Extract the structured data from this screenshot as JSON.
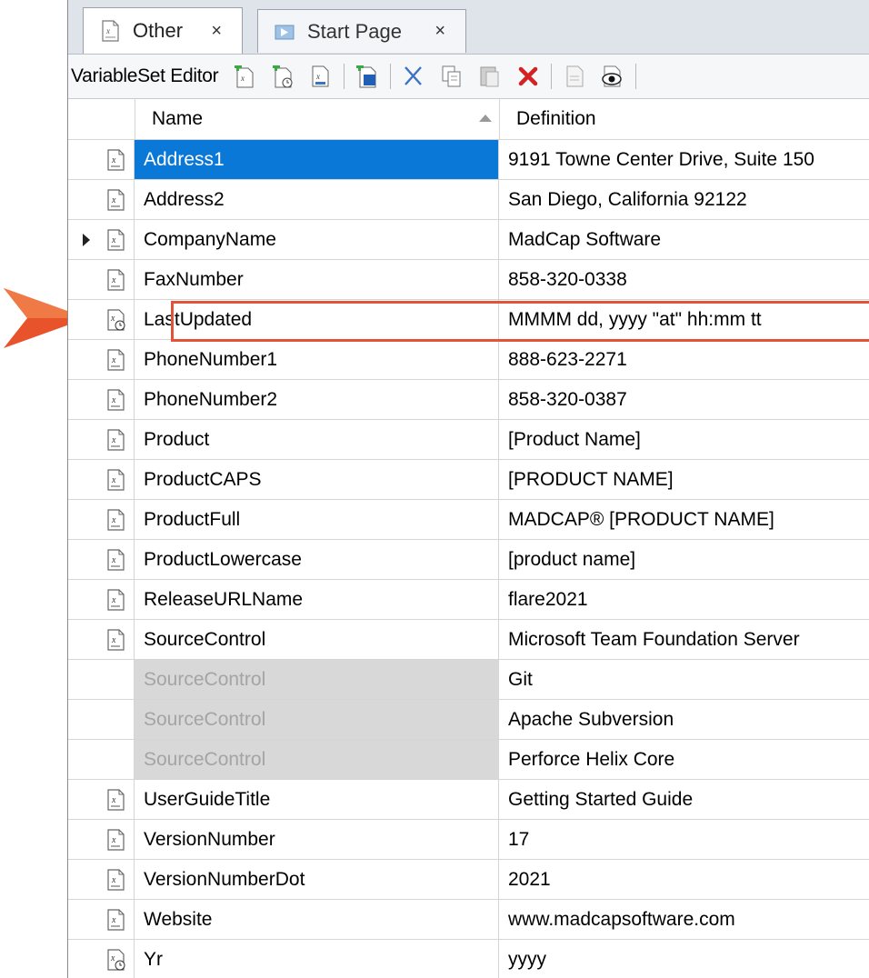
{
  "tabs": [
    {
      "label": "Other",
      "close": "×",
      "active": true,
      "icon": "variable-set-file-icon"
    },
    {
      "label": "Start Page",
      "close": "×",
      "active": false,
      "icon": "start-page-icon"
    }
  ],
  "toolbar": {
    "title": "VariableSet Editor",
    "buttons": [
      {
        "name": "add-text-variable-button",
        "icon": "add-variable-icon"
      },
      {
        "name": "add-datetime-variable-button",
        "icon": "add-datetime-variable-icon"
      },
      {
        "name": "edit-variable-button",
        "icon": "edit-variable-icon"
      },
      {
        "name": "add-definition-button",
        "icon": "add-definition-icon"
      },
      {
        "name": "cut-button",
        "icon": "scissors-icon"
      },
      {
        "name": "copy-button",
        "icon": "copy-icon"
      },
      {
        "name": "paste-button",
        "icon": "paste-icon"
      },
      {
        "name": "delete-button",
        "icon": "delete-x-icon"
      },
      {
        "name": "properties-button",
        "icon": "properties-icon"
      },
      {
        "name": "show-hide-button",
        "icon": "eye-icon"
      }
    ]
  },
  "grid": {
    "headers": {
      "name": "Name",
      "definition": "Definition"
    },
    "sort": "ascending",
    "rows": [
      {
        "name": "Address1",
        "definition": "9191 Towne Center Drive, Suite 150",
        "type": "text",
        "selected": true
      },
      {
        "name": "Address2",
        "definition": "San Diego, California 92122",
        "type": "text"
      },
      {
        "name": "CompanyName",
        "definition": "MadCap Software",
        "type": "text",
        "expandable": true
      },
      {
        "name": "FaxNumber",
        "definition": "858-320-0338",
        "type": "text"
      },
      {
        "name": "LastUpdated",
        "definition": "MMMM dd, yyyy \"at\" hh:mm tt",
        "type": "datetime",
        "highlighted": true
      },
      {
        "name": "PhoneNumber1",
        "definition": "888-623-2271",
        "type": "text"
      },
      {
        "name": "PhoneNumber2",
        "definition": "858-320-0387",
        "type": "text"
      },
      {
        "name": "Product",
        "definition": "[Product Name]",
        "type": "text"
      },
      {
        "name": "ProductCAPS",
        "definition": "[PRODUCT NAME]",
        "type": "text"
      },
      {
        "name": "ProductFull",
        "definition": "MADCAP® [PRODUCT NAME]",
        "type": "text"
      },
      {
        "name": "ProductLowercase",
        "definition": "[product name]",
        "type": "text"
      },
      {
        "name": "ReleaseURLName",
        "definition": "flare2021",
        "type": "text"
      },
      {
        "name": "SourceControl",
        "definition": "Microsoft Team Foundation Server",
        "type": "text"
      },
      {
        "name": "SourceControl",
        "definition": "Git",
        "type": "child"
      },
      {
        "name": "SourceControl",
        "definition": "Apache Subversion",
        "type": "child"
      },
      {
        "name": "SourceControl",
        "definition": "Perforce Helix Core",
        "type": "child"
      },
      {
        "name": "UserGuideTitle",
        "definition": "Getting Started Guide",
        "type": "text"
      },
      {
        "name": "VersionNumber",
        "definition": "17",
        "type": "text"
      },
      {
        "name": "VersionNumberDot",
        "definition": "2021",
        "type": "text"
      },
      {
        "name": "Website",
        "definition": "www.madcapsoftware.com",
        "type": "text"
      },
      {
        "name": "Yr",
        "definition": "yyyy",
        "type": "datetime"
      }
    ]
  },
  "colors": {
    "selection": "#0a78d7",
    "highlight_border": "#e2533a",
    "pointer": "#e8532b",
    "child_row": "#d8d8d8"
  }
}
